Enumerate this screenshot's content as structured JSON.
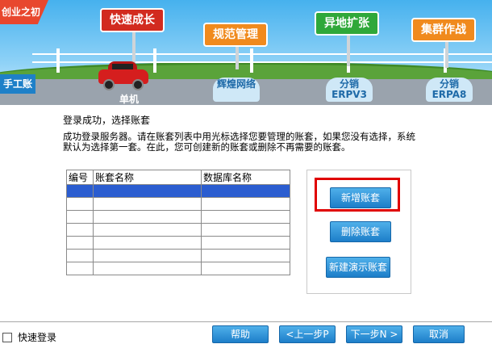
{
  "banner": {
    "corner": "创业之初",
    "stages": [
      "快速成长",
      "规范管理",
      "异地扩张",
      "集群作战"
    ],
    "signs": [
      "手工账",
      "辉煌网络",
      "分销ERPV3",
      "分销ERPA8"
    ],
    "car_label": "单机"
  },
  "content": {
    "title": "登录成功，选择账套",
    "description": "成功登录服务器。请在账套列表中用光标选择您要管理的账套，如果您没有选择，系统默认为选择第一套。在此，您可创建新的账套或删除不再需要的账套。",
    "table": {
      "headers": [
        "编号",
        "账套名称",
        "数据库名称"
      ],
      "rows": [
        [
          "",
          "",
          ""
        ],
        [
          "",
          "",
          ""
        ],
        [
          "",
          "",
          ""
        ],
        [
          "",
          "",
          ""
        ],
        [
          "",
          "",
          ""
        ],
        [
          "",
          "",
          ""
        ],
        [
          "",
          "",
          ""
        ]
      ]
    },
    "buttons": {
      "add": "新增账套",
      "delete": "删除账套",
      "demo": "新建演示账套"
    }
  },
  "footer": {
    "quick_login": "快速登录",
    "help": "帮助",
    "prev": "<上一步P",
    "next": "下一步N >",
    "cancel": "取消"
  },
  "colors": {
    "selected_row": "#2b5dd0",
    "button": "#1d7ec9",
    "highlight": "#e00000"
  }
}
